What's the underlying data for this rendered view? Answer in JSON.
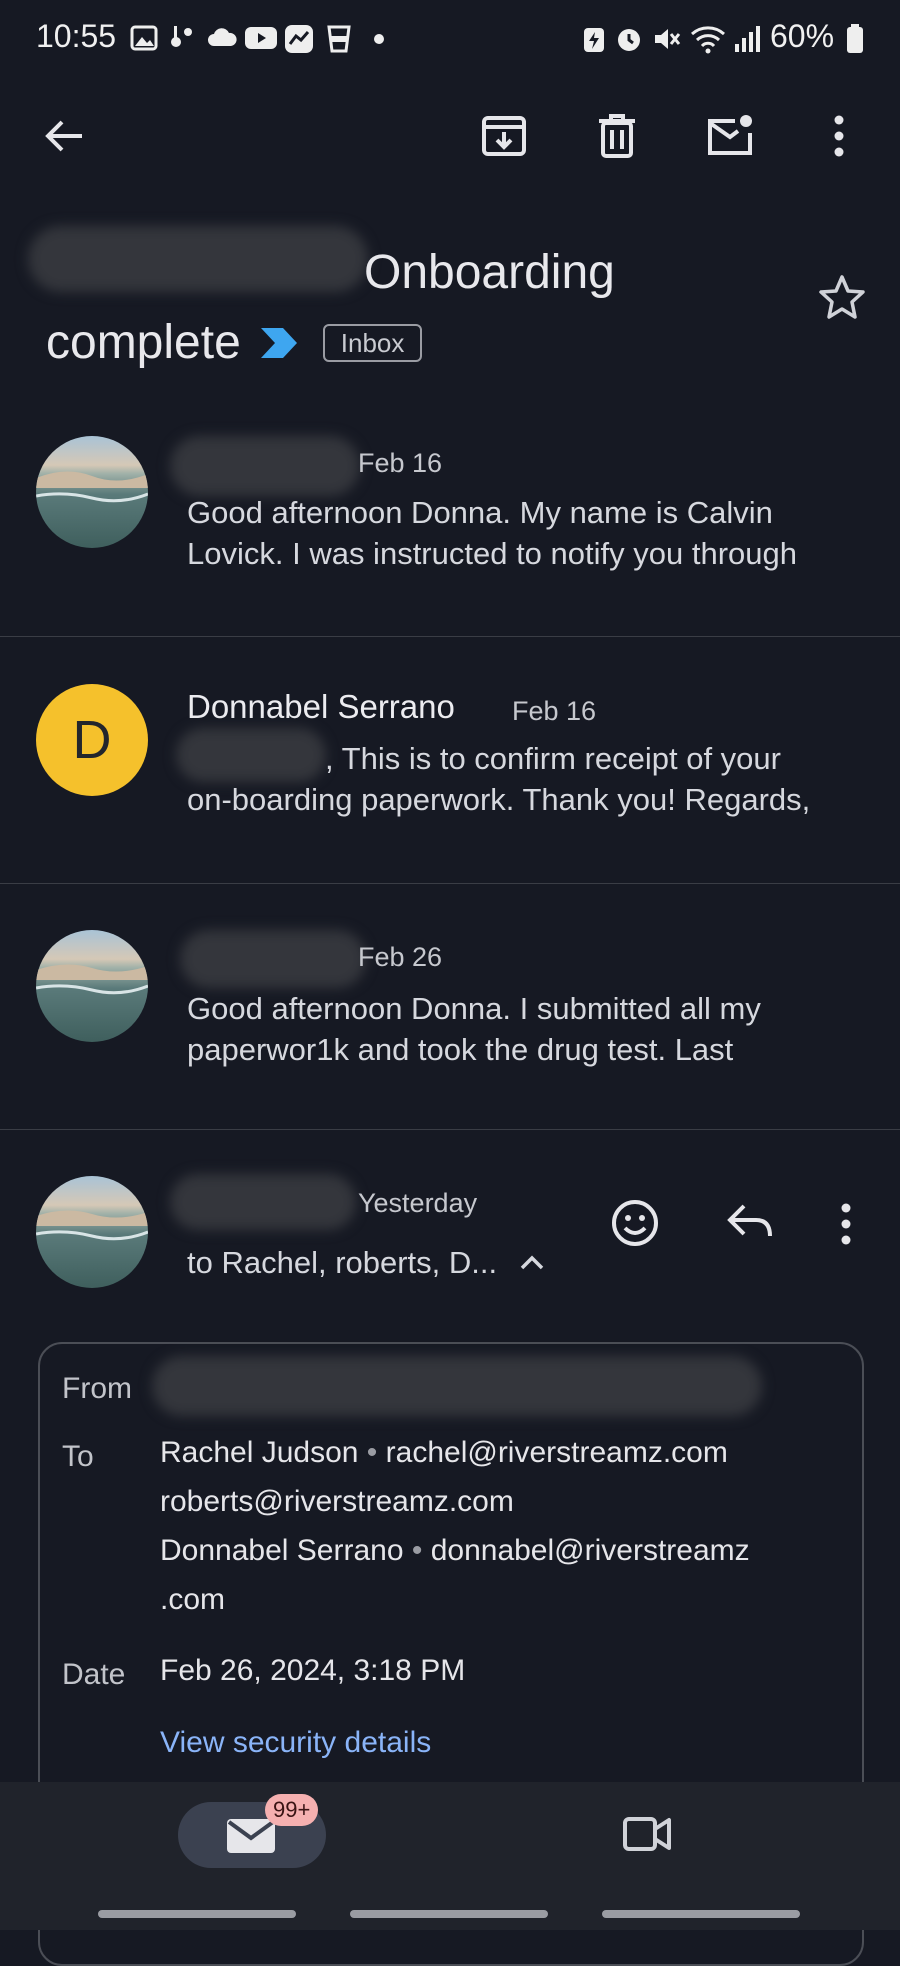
{
  "status_bar": {
    "time": "10:55",
    "battery_percent": "60%"
  },
  "toolbar": {
    "icons": [
      "back-arrow-icon",
      "archive-icon",
      "delete-icon",
      "mark-unread-icon",
      "more-vert-icon"
    ]
  },
  "subject": {
    "line1_visible": "Onboarding",
    "line2": "complete",
    "label": "Inbox"
  },
  "thread": [
    {
      "date": "Feb 16",
      "snippet_line1": "Good afternoon Donna. My name is Calvin",
      "snippet_line2": "Lovick. I was instructed to notify you through"
    },
    {
      "sender": "Donnabel Serrano",
      "avatar_letter": "D",
      "date": "Feb 16",
      "snippet_line1": ", This is to confirm receipt of your",
      "snippet_line2": "on-boarding paperwork. Thank you! Regards,"
    },
    {
      "date": "Feb 26",
      "snippet_line1": "Good afternoon Donna. I submitted all my",
      "snippet_line2": "paperwor1k and took the drug test. Last"
    },
    {
      "date": "Yesterday",
      "recipients": "to Rachel, roberts, D..."
    }
  ],
  "details": {
    "from_label": "From",
    "to_label": "To",
    "to_lines": [
      {
        "name": "Rachel Judson",
        "email": "rachel@riverstreamz.com"
      },
      {
        "name": "",
        "email": "roberts@riverstreamz.com"
      },
      {
        "name": "Donnabel Serrano",
        "email": "donnabel@riverstreamz"
      },
      {
        "name": "",
        "email": ".com"
      }
    ],
    "date_label": "Date",
    "date_value": "Feb 26, 2024, 3:18 PM",
    "security_link": "View security details"
  },
  "bottom_nav": {
    "mail_badge": "99+"
  },
  "colors": {
    "background": "#161923",
    "accent_link": "#8ab4f8",
    "avatar_yellow": "#f5c12c",
    "importance_marker": "#3ea6f0"
  }
}
